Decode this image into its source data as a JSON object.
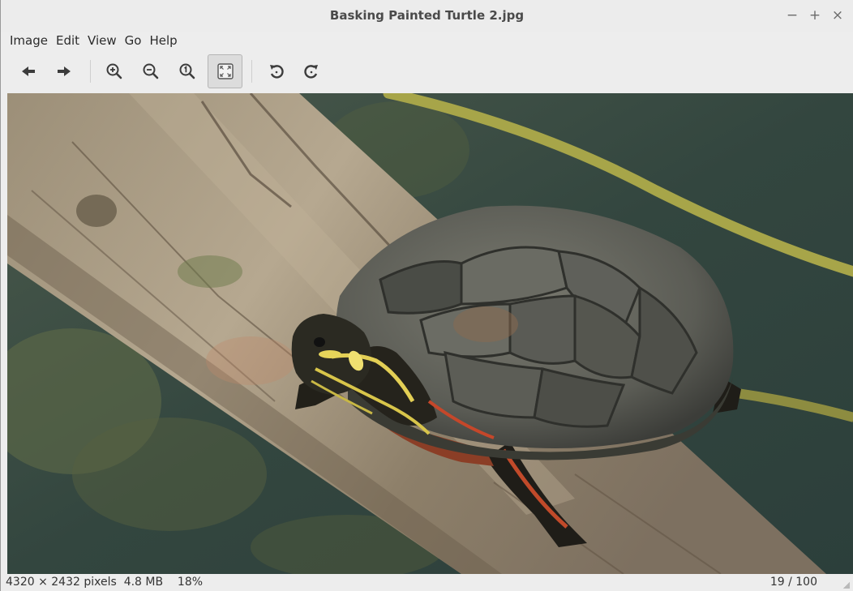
{
  "window": {
    "title": "Basking Painted Turtle 2.jpg",
    "controls": [
      {
        "name": "minimize",
        "glyph": "−"
      },
      {
        "name": "maximize",
        "glyph": "+"
      },
      {
        "name": "close",
        "glyph": "×"
      }
    ]
  },
  "menubar": {
    "items": [
      "Image",
      "Edit",
      "View",
      "Go",
      "Help"
    ]
  },
  "toolbar": {
    "buttons": [
      {
        "icon": "arrow-left-icon"
      },
      {
        "icon": "arrow-right-icon"
      },
      {
        "icon": "zoom-in-icon"
      },
      {
        "icon": "zoom-out-icon"
      },
      {
        "icon": "zoom-original-icon"
      },
      {
        "icon": "zoom-fit-icon",
        "active": true
      },
      {
        "icon": "rotate-left-icon"
      },
      {
        "icon": "rotate-right-icon"
      }
    ]
  },
  "image": {
    "description_icon": "photo-turtle-on-log"
  },
  "status": {
    "dimensions": "4320 × 2432 pixels",
    "file_size": "4.8 MB",
    "zoom": "18%",
    "position": "19 / 100"
  },
  "colors": {
    "chrome_bg": "#ededed",
    "text": "#2e2e2e",
    "water": "#3b4c47",
    "log": "#8c7d6a"
  }
}
